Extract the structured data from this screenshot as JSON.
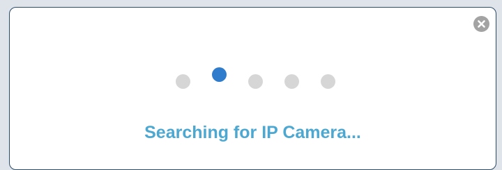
{
  "dialog": {
    "status_text": "Searching for IP Camera...",
    "close_icon": "close-circle-icon",
    "loader": {
      "dot_count": 5,
      "active_index": 1,
      "active_color": "#2f7ccc",
      "inactive_color": "#d6d6d6"
    },
    "text_color": "#4ca8d1"
  }
}
